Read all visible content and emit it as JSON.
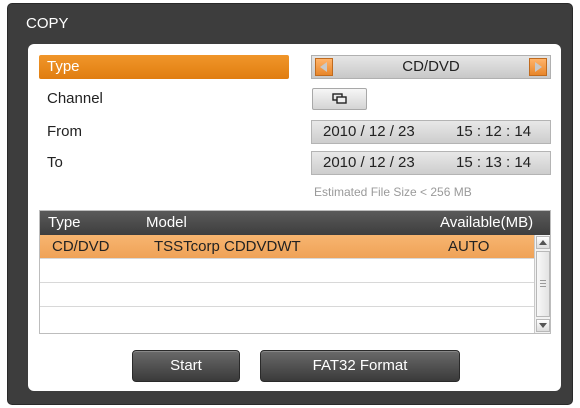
{
  "dialog": {
    "title": "COPY"
  },
  "form": {
    "type_label": "Type",
    "type_value": "CD/DVD",
    "channel_label": "Channel",
    "from_label": "From",
    "to_label": "To",
    "from": {
      "date": "2010 / 12 / 23",
      "time": "15 : 12 : 14"
    },
    "to": {
      "date": "2010 / 12 / 23",
      "time": "15 : 13 : 14"
    },
    "estimated": "Estimated File Size < 256 MB"
  },
  "table": {
    "headers": {
      "type": "Type",
      "model": "Model",
      "available": "Available(MB)"
    },
    "rows": [
      {
        "type": "CD/DVD",
        "model": "TSSTcorp CDDVDWT",
        "available": "AUTO"
      }
    ]
  },
  "buttons": {
    "start": "Start",
    "fat32": "FAT32 Format"
  },
  "colors": {
    "accent": "#e8861c",
    "selected_row": "#f0a65c",
    "frame": "#3d3d3d"
  }
}
